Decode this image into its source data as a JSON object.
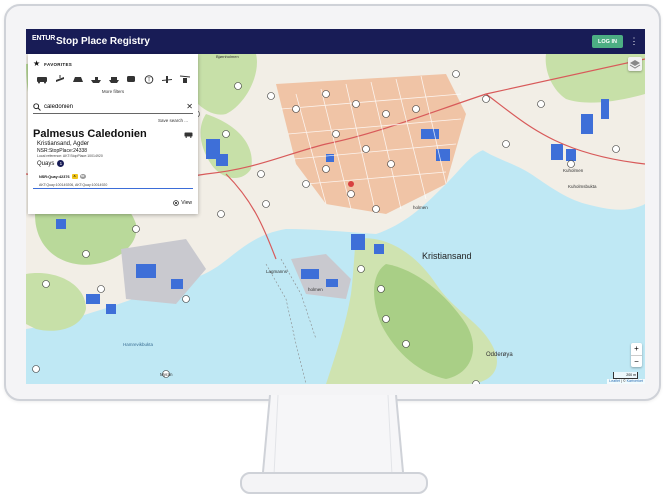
{
  "app": {
    "logo_text": "ENTUR",
    "title": "Stop Place Registry",
    "login_label": "LOG IN",
    "menu_glyph": "⋮"
  },
  "favorites": {
    "label": "FAVORITES"
  },
  "transport_modes": [
    "bus-icon",
    "tram-icon",
    "rail-icon",
    "water-icon",
    "ferry-icon",
    "metro-icon",
    "info-icon",
    "air-icon",
    "cableway-icon"
  ],
  "more_filters": "More filters",
  "search": {
    "value": "caledonien",
    "save_label": "Save search ..."
  },
  "stop_place": {
    "name": "Palmesus Caledonien",
    "location": "Kristiansand, Agder",
    "nsr_id": "NSR:StopPlace:24338",
    "local_reference": "Local reference: AKT:StopPlace:10014920",
    "quays_label": "Quays",
    "quays_count": "1",
    "quay_id": "NSR:Quay:42376",
    "quay_badge_a": "A",
    "quay_badge_b": "60",
    "quay_refs": "AKT:Quay:100149206, AKT:Quay:10014920",
    "view_label": "View"
  },
  "map": {
    "labels": {
      "city": "Kristiansand",
      "holmen": "holmen",
      "lagmanns": "Lagmanns-",
      "lagmanns2": "holmen",
      "hamrevik": "Hamrevikbukta",
      "odderoya": "Odderøya",
      "myran": "Myran",
      "kuholmen": "Kuholmen",
      "kuholmsbukta": "Kuholmsbukta",
      "bjornholm": "Bjørnholmen"
    },
    "scale": "200 m",
    "attribution_leaflet": "Leaflet",
    "attribution_sep": " | © ",
    "attribution_source": "Kartverket"
  },
  "colors": {
    "appbar": "#181c56",
    "login": "#4cae83",
    "water": "#bfe8f4",
    "land": "#f2eee6",
    "city": "#f0c4a6",
    "forest": "#b9d99a",
    "building": "#3e6fd8"
  }
}
